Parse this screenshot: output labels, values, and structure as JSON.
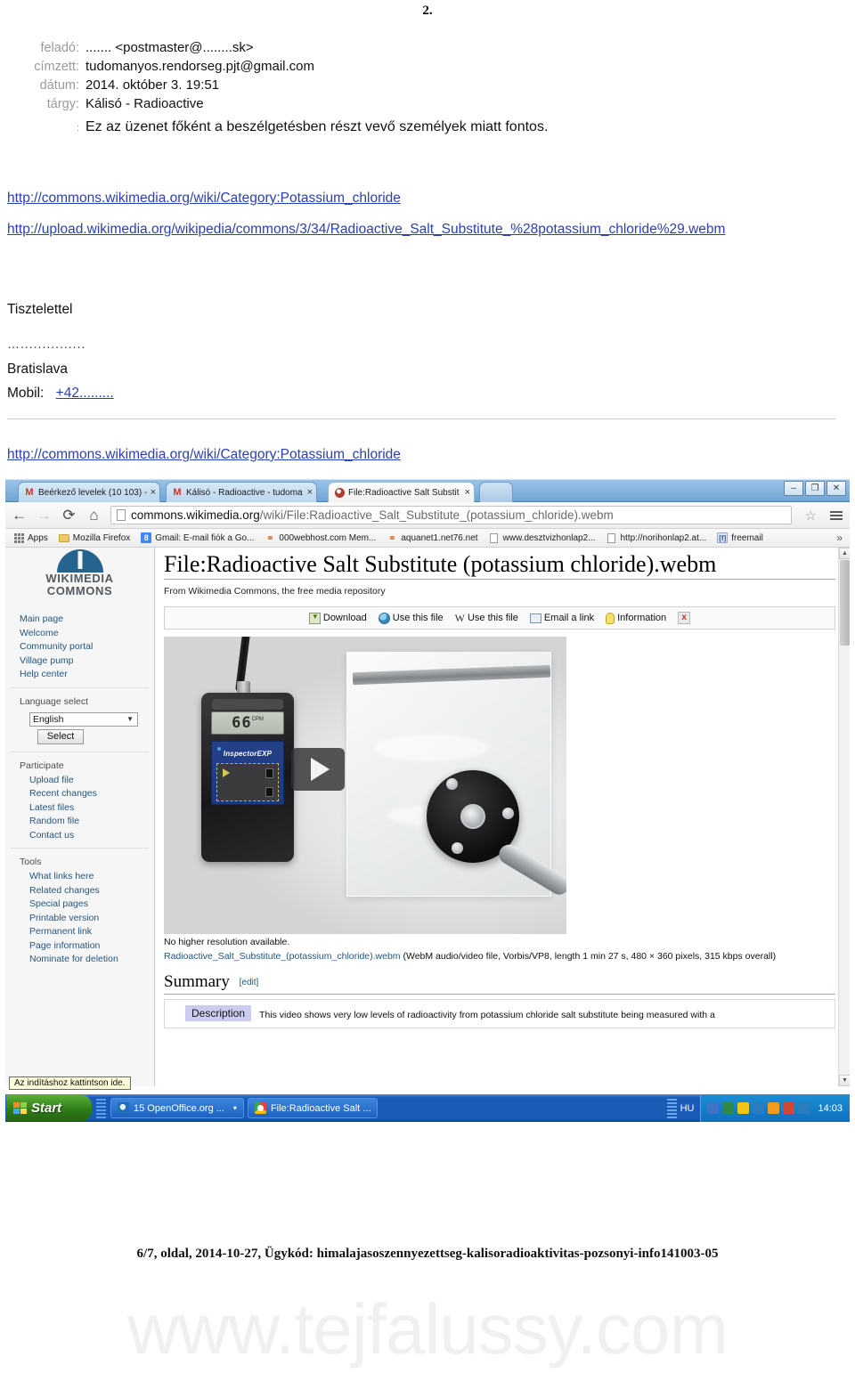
{
  "page_number": "2.",
  "email": {
    "rows": [
      {
        "label": "feladó:",
        "value": "....... <postmaster@........sk>"
      },
      {
        "label": "címzett:",
        "value": "tudomanyos.rendorseg.pjt@gmail.com"
      },
      {
        "label": "dátum:",
        "value": "2014. október 3. 19:51"
      },
      {
        "label": "tárgy:",
        "value": "Kálisó - Radioactive"
      },
      {
        "label": ":",
        "value": "Ez az üzenet főként a beszélgetésben részt vevő személyek miatt fontos."
      }
    ]
  },
  "body": {
    "link1": "http://commons.wikimedia.org/wiki/Category:Potassium_chloride",
    "link2": "http://upload.wikimedia.org/wikipedia/commons/3/34/Radioactive_Salt_Substitute_%28potassium_chloride%29.webm",
    "closing": "Tisztelettel",
    "dots": "…...............",
    "city": "Bratislava",
    "mobil_label": "Mobil:",
    "mobil_value": "+42.........",
    "link3": "http://commons.wikimedia.org/wiki/Category:Potassium_chloride"
  },
  "browser": {
    "tabs": [
      {
        "title": "Beérkező levelek (10 103) - ",
        "icon": "gmail-icon",
        "close": "×"
      },
      {
        "title": "Kálisó - Radioactive - tudoma",
        "icon": "gmail-icon",
        "close": "×"
      },
      {
        "title": "File:Radioactive Salt Substit",
        "icon": "wikimedia-icon",
        "close": "×"
      }
    ],
    "window_buttons": {
      "minimize": "–",
      "maximize": "❐",
      "close": "✕"
    },
    "nav": {
      "back": "←",
      "forward": "→",
      "reload": "⟳",
      "home": "⌂"
    },
    "address": {
      "host": "commons.wikimedia.org",
      "path": "/wiki/File:Radioactive_Salt_Substitute_(potassium_chloride).webm",
      "bookmark_star": "☆"
    },
    "bookmarks": [
      {
        "label": "Apps",
        "icon": "apps-grid-icon"
      },
      {
        "label": "Mozilla Firefox",
        "icon": "folder-icon"
      },
      {
        "label": "Gmail: E-mail fiók a Go...",
        "icon": "google-icon"
      },
      {
        "label": "000webhost.com Mem...",
        "icon": "firefox-icon"
      },
      {
        "label": "aquanet1.net76.net",
        "icon": "firefox-icon"
      },
      {
        "label": "www.desztvizhonlap2...",
        "icon": "page-icon"
      },
      {
        "label": "http://norihonlap2.at...",
        "icon": "page-icon"
      },
      {
        "label": "freemail",
        "icon": "freemail-icon"
      }
    ],
    "bookmarks_overflow": "»"
  },
  "wiki": {
    "logo_line1": "WIKIMEDIA",
    "logo_line2": "COMMONS",
    "nav_links": [
      "Main page",
      "Welcome",
      "Community portal",
      "Village pump",
      "Help center"
    ],
    "language": {
      "heading": "Language select",
      "selected": "English",
      "button": "Select",
      "caret": "▼"
    },
    "participate": {
      "heading": "Participate",
      "items": [
        "Upload file",
        "Recent changes",
        "Latest files",
        "Random file",
        "Contact us"
      ]
    },
    "tools": {
      "heading": "Tools",
      "items": [
        "What links here",
        "Related changes",
        "Special pages",
        "Printable version",
        "Permanent link",
        "Page information",
        "Nominate for deletion"
      ]
    },
    "title": "File:Radioactive Salt Substitute (potassium chloride).webm",
    "subtitle": "From Wikimedia Commons, the free media repository",
    "actions": [
      "Download",
      "Use this file",
      "Use this file",
      "Email a link",
      "Information"
    ],
    "action_close": "x",
    "media": {
      "lcd_value": "66",
      "lcd_unit": "CPM",
      "device_brand": "InspectorEXP",
      "play": "▶"
    },
    "no_higher": "No higher resolution available.",
    "file_link": "Radioactive_Salt_Substitute_(potassium_chloride).webm",
    "file_meta": " (WebM audio/video file, Vorbis/VP8, length 1 min 27 s, 480 × 360 pixels, 315 kbps overall)",
    "summary_heading": "Summary",
    "summary_edit": "[edit]",
    "description_label": "Description",
    "description_text": "This video shows very low levels of radioactivity from potassium chloride salt substitute being measured with a"
  },
  "taskbar": {
    "tooltip": "Az indításhoz kattintson ide.",
    "start": "Start",
    "buttons": [
      {
        "label": "15 OpenOffice.org ...",
        "icon": "openoffice-icon",
        "caret": "▾"
      },
      {
        "label": "File:Radioactive Salt ...",
        "icon": "chrome-icon",
        "caret": ""
      }
    ],
    "lang": "HU",
    "clock": "14:03",
    "tray_icons": [
      "network-icon",
      "printer-icon",
      "shield-icon",
      "openoffice-icon",
      "update-icon",
      "antivirus-icon",
      "messenger-icon"
    ]
  },
  "footer": "6/7, oldal, 2014-10-27, Ügykód: himalajasoszennyezettseg-kalisoradioaktivitas-pozsonyi-info141003-05",
  "watermark": "www.tejfalussy.com",
  "colors": {
    "link": "#2a3fb5",
    "wiki_link": "#24557e",
    "taskbar": "#1a5bb8",
    "start": "#2f7d18"
  }
}
